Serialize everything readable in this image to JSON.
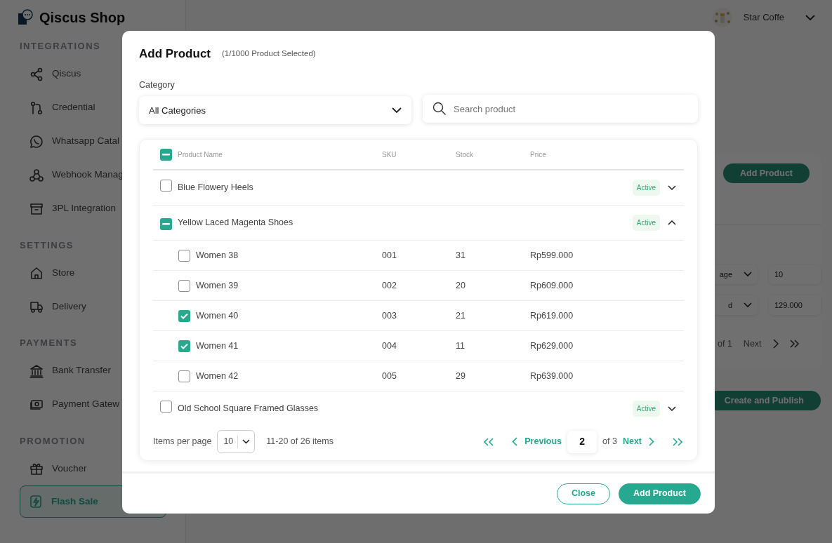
{
  "app": {
    "title": "Qiscus Shop",
    "user": "Star Coffe"
  },
  "sidebar": {
    "sections": [
      {
        "title": "INTEGRATIONS",
        "items": [
          {
            "label": "Qiscus",
            "kind": "share",
            "selected": false
          },
          {
            "label": "Credential",
            "kind": "branch",
            "selected": false
          },
          {
            "label": "Whatsapp Catal",
            "kind": "chat",
            "selected": false
          },
          {
            "label": "Webhook Manag",
            "kind": "webhook",
            "selected": false
          },
          {
            "label": "3PL Integration",
            "kind": "archive",
            "selected": false
          }
        ]
      },
      {
        "title": "SETTINGS",
        "items": [
          {
            "label": "Store",
            "kind": "house",
            "selected": false
          },
          {
            "label": "Delivery",
            "kind": "truck",
            "selected": false
          }
        ]
      },
      {
        "title": "PAYMENTS",
        "items": [
          {
            "label": "Bank Transfer",
            "kind": "bank",
            "selected": false
          },
          {
            "label": "Payment Gatew",
            "kind": "cash",
            "selected": false
          }
        ]
      },
      {
        "title": "PROMOTION",
        "items": [
          {
            "label": "Voucher",
            "kind": "gift",
            "selected": false
          },
          {
            "label": "Flash Sale",
            "kind": "bolt",
            "selected": true
          }
        ]
      }
    ]
  },
  "background": {
    "add_button": "Add Product",
    "rows": [
      {
        "select": "age",
        "value": "10"
      },
      {
        "select": "d",
        "value": "129.000"
      }
    ],
    "pager": {
      "of": "of 1",
      "next": "Next"
    },
    "publish_button": "Create and Publish"
  },
  "modal": {
    "title": "Add Product",
    "subtitle": "(1/1000 Product Selected)",
    "category_label": "Category",
    "category_value": "All Categories",
    "search": {
      "placeholder": "Search product"
    },
    "table": {
      "header_checkbox": {
        "indeterminate": true
      },
      "columns": [
        "Product Name",
        "SKU",
        "Stock",
        "Price"
      ],
      "rows": [
        {
          "name": "Blue Flowery Heels",
          "checked": false,
          "indeterminate": false,
          "status": "Active",
          "expanded": false,
          "children": []
        },
        {
          "name": "Yellow Laced Magenta Shoes",
          "indeterminate": true,
          "status": "Active",
          "expanded": true,
          "children": [
            {
              "name": "Women 38",
              "sku": "001",
              "stock": "31",
              "price": "Rp599.000",
              "checked": false
            },
            {
              "name": "Women 39",
              "sku": "002",
              "stock": "20",
              "price": "Rp609.000",
              "checked": false
            },
            {
              "name": "Women 40",
              "sku": "003",
              "stock": "21",
              "price": "Rp619.000",
              "checked": true
            },
            {
              "name": "Women 41",
              "sku": "004",
              "stock": "11",
              "price": "Rp629.000",
              "checked": true
            },
            {
              "name": "Women 42",
              "sku": "005",
              "stock": "29",
              "price": "Rp639.000",
              "checked": false
            }
          ]
        },
        {
          "name": "Old School Square Framed Glasses",
          "checked": false,
          "indeterminate": false,
          "status": "Active",
          "expanded": false,
          "children": []
        }
      ]
    },
    "pagination": {
      "items_per_page_label": "Items per page",
      "per_page": "10",
      "range": "11-20 of 26 items",
      "previous": "Previous",
      "page": "2",
      "of": "of 3",
      "next": "Next"
    },
    "buttons": [
      {
        "label": "Close",
        "kind": "outline"
      },
      {
        "label": "Add Product",
        "kind": "primary"
      }
    ]
  }
}
